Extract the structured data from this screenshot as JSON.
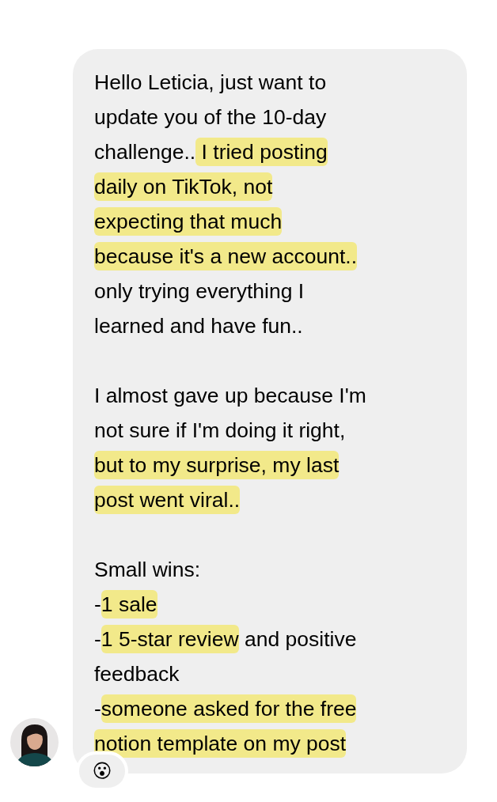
{
  "message": {
    "paragraphs": [
      {
        "lines": [
          [
            {
              "text": "Hello Leticia, just want to",
              "highlighted": false
            }
          ],
          [
            {
              "text": "update you of the 10-day",
              "highlighted": false
            }
          ],
          [
            {
              "text": "challenge..",
              "highlighted": false
            },
            {
              "text": " I tried posting",
              "highlighted": true
            }
          ],
          [
            {
              "text": "daily on TikTok, not",
              "highlighted": true
            }
          ],
          [
            {
              "text": "expecting that much",
              "highlighted": true
            }
          ],
          [
            {
              "text": "because it's a new account..",
              "highlighted": true
            }
          ],
          [
            {
              "text": "only trying everything I",
              "highlighted": false
            }
          ],
          [
            {
              "text": "learned and have fun..",
              "highlighted": false
            }
          ]
        ]
      },
      {
        "lines": [
          [
            {
              "text": "I almost gave up because I'm",
              "highlighted": false
            }
          ],
          [
            {
              "text": "not sure if I'm doing it right,",
              "highlighted": false
            }
          ],
          [
            {
              "text": "but to my surprise, my last",
              "highlighted": true
            }
          ],
          [
            {
              "text": "post went viral..",
              "highlighted": true
            }
          ]
        ]
      },
      {
        "lines": [
          [
            {
              "text": "Small wins:",
              "highlighted": false
            }
          ],
          [
            {
              "text": "-",
              "highlighted": false
            },
            {
              "text": "1 sale",
              "highlighted": true
            }
          ],
          [
            {
              "text": "-",
              "highlighted": false
            },
            {
              "text": "1 5-star review",
              "highlighted": true
            },
            {
              "text": " and positive",
              "highlighted": false
            }
          ],
          [
            {
              "text": "feedback",
              "highlighted": false
            }
          ],
          [
            {
              "text": "-",
              "highlighted": false
            },
            {
              "text": "someone asked for the free",
              "highlighted": true
            }
          ],
          [
            {
              "text": "notion template on my post",
              "highlighted": true
            }
          ]
        ]
      }
    ],
    "reaction": "😮"
  }
}
